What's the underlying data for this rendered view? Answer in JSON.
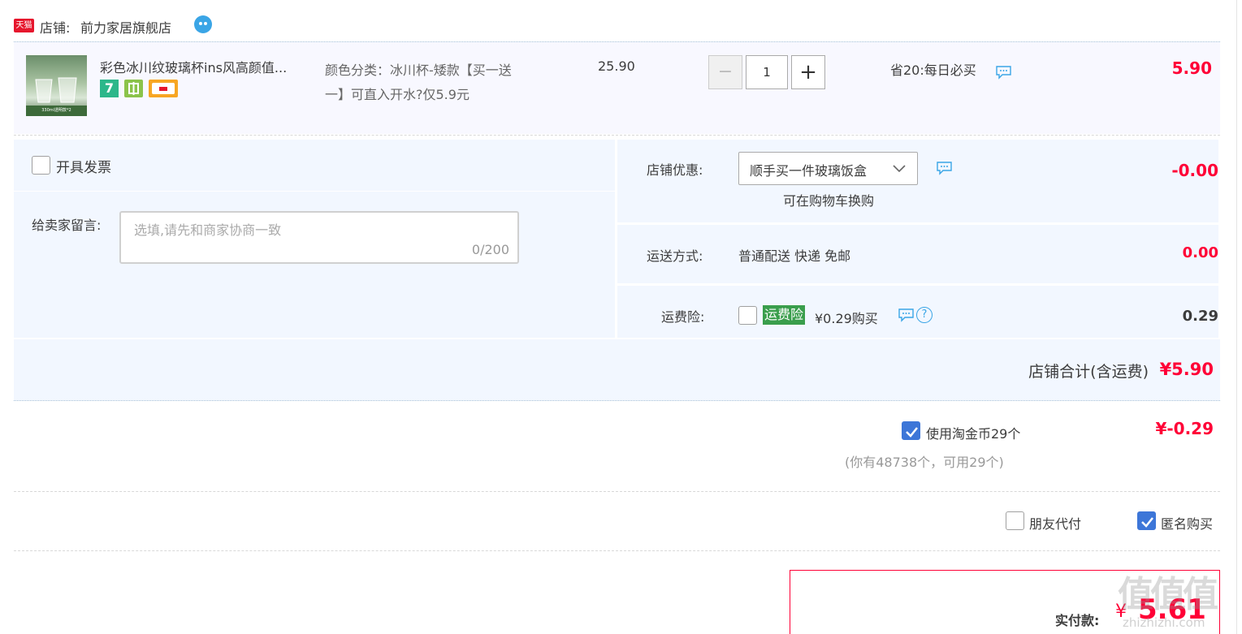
{
  "shop": {
    "badge": "天猫",
    "label": "店铺:",
    "name": "前力家居旗舰店"
  },
  "item": {
    "thumb_caption": "330ml透明款*2",
    "title": "彩色冰川纹玻璃杯ins风高颜值...",
    "sku_line1": "颜色分类：冰川杯-矮款【买一送",
    "sku_line2": "一】可直入开水?仅5.9元",
    "unit_price": "25.90",
    "quantity": "1",
    "minus": "−",
    "plus": "+",
    "promo": "省20:每日必买",
    "subtotal": "5.90"
  },
  "invoice": {
    "label": "开具发票"
  },
  "note": {
    "label": "给卖家留言:",
    "placeholder": "选填,请先和商家协商一致",
    "counter": "0/200"
  },
  "discount": {
    "label": "店铺优惠:",
    "selected": "顺手买一件玻璃饭盒",
    "hint": "可在购物车换购",
    "amount": "-0.00"
  },
  "shipping": {
    "label": "运送方式:",
    "value": "普通配送 快递 免邮",
    "amount": "0.00"
  },
  "insurance": {
    "label": "运费险:",
    "badge": "运费险",
    "price": "¥0.29购买",
    "help": "?",
    "amount": "0.29"
  },
  "shop_total": {
    "label": "店铺合计(含运费)",
    "amount": "¥5.90"
  },
  "coins": {
    "label": "使用淘金币29个",
    "sub": "(你有48738个，可用29个)",
    "amount": "¥-0.29"
  },
  "options": {
    "friend_pay": "朋友代付",
    "anonymous": "匿名购买"
  },
  "pay": {
    "label": "实付款:",
    "currency": "¥",
    "amount": "5.61"
  },
  "watermark": {
    "big": "值值值",
    "small": "zhizhizhi.com"
  },
  "colors": {
    "accent_red": "#ff0036",
    "panel_bg": "#f2f7ff",
    "check_blue": "#3d76d8",
    "insurance_green": "#3a9e4c"
  }
}
